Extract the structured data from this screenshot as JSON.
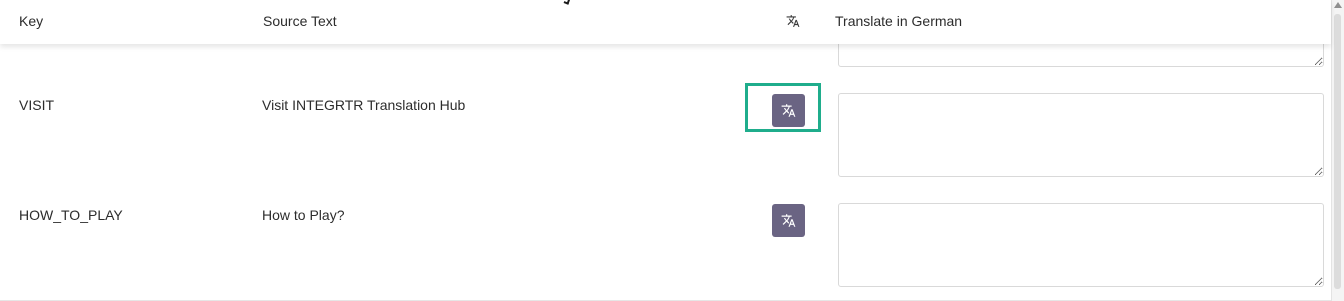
{
  "table": {
    "headers": {
      "key": "Key",
      "source_text": "Source Text",
      "translate_icon": "translate-icon",
      "target": "Translate in German"
    },
    "rows": [
      {
        "key": "",
        "source_text": "",
        "translation_value": ""
      },
      {
        "key": "VISIT",
        "source_text": "Visit INTEGRTR Translation Hub",
        "translation_value": "",
        "highlighted": true
      },
      {
        "key": "HOW_TO_PLAY",
        "source_text": "How to Play?",
        "translation_value": ""
      }
    ]
  },
  "colors": {
    "translate_button": "#6a6483",
    "highlight_border": "#1fad8c"
  }
}
